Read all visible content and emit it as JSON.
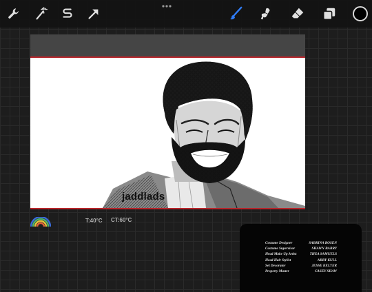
{
  "toolbar": {
    "left_tools": [
      {
        "icon": "wrench-icon",
        "name": "actions"
      },
      {
        "icon": "magic-wand-icon",
        "name": "adjustments"
      },
      {
        "icon": "selection-s-icon",
        "name": "selection"
      },
      {
        "icon": "transform-arrow-icon",
        "name": "transform"
      }
    ],
    "right_tools": [
      {
        "icon": "brush-icon",
        "name": "paint",
        "active": true
      },
      {
        "icon": "smudge-icon",
        "name": "smudge"
      },
      {
        "icon": "eraser-icon",
        "name": "erase"
      },
      {
        "icon": "layers-icon",
        "name": "layers"
      }
    ],
    "more_icon": "more-dots-icon",
    "accent_color": "#2f7bf5",
    "current_color": "#000000"
  },
  "canvas": {
    "caption": "jaddlads",
    "border_color": "#b8242a"
  },
  "status": {
    "temperature": "T:40°C",
    "color_temperature": "CT:60°C"
  },
  "credits": [
    {
      "role": "Costume Designer",
      "name": "SABRINA ROSEN"
    },
    {
      "role": "Costume Supervisor",
      "name": "SHAWN BARRY"
    },
    {
      "role": "Head Make Up Artist",
      "name": "THEA SAMUELS"
    },
    {
      "role": "Head Hair Stylist",
      "name": "ABBY KULL"
    },
    {
      "role": "Set Decorator",
      "name": "JESSE KELTER"
    },
    {
      "role": "Property Master",
      "name": "CASEY SHAW"
    }
  ]
}
